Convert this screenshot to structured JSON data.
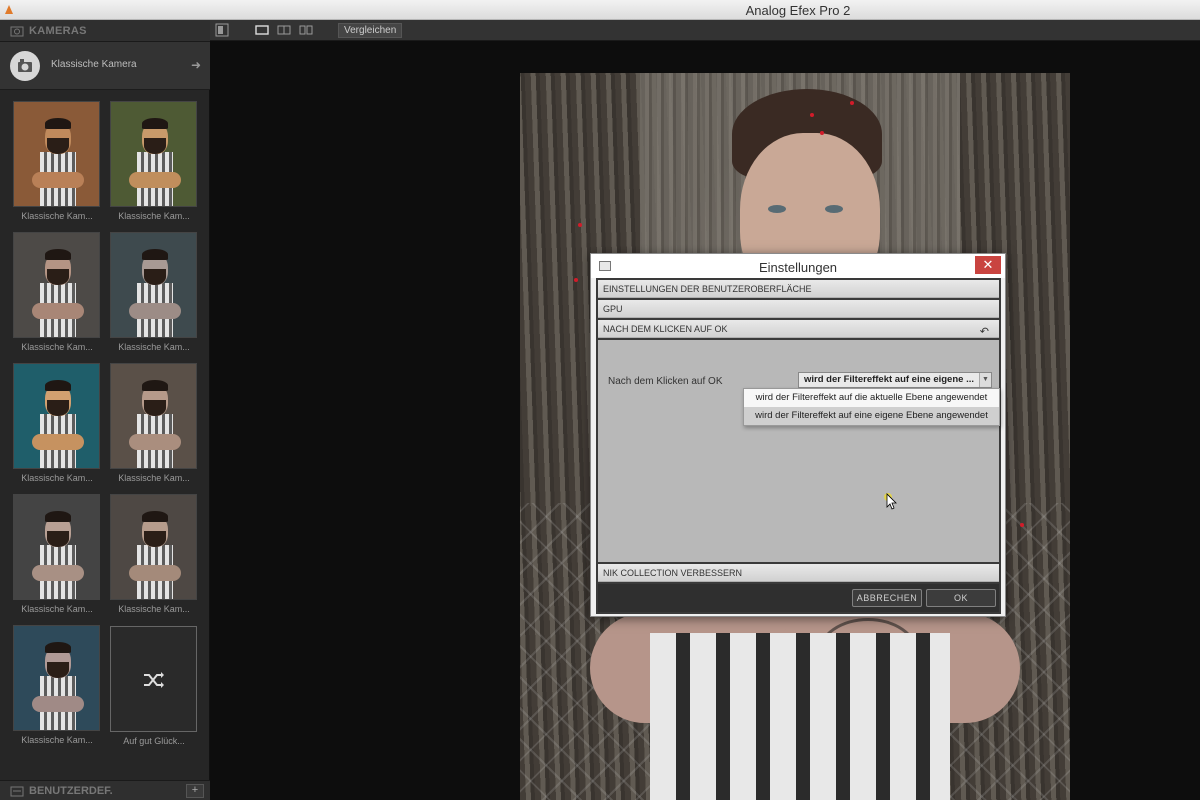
{
  "window": {
    "title": "Analog Efex Pro 2"
  },
  "toolbar": {
    "compare_label": "Vergleichen"
  },
  "left_panel": {
    "section_title": "KAMERAS",
    "camera_type": "Klassische Kamera",
    "presets": [
      {
        "label": "Klassische Kam...",
        "skin": "#c08a5c",
        "bg": "#8a5a38",
        "arms": "#b98057"
      },
      {
        "label": "Klassische Kam...",
        "skin": "#c89a6a",
        "bg": "#4e5a34",
        "arms": "#c08e5c"
      },
      {
        "label": "Klassische Kam...",
        "skin": "#b49484",
        "bg": "#4d4a47",
        "arms": "#a88676"
      },
      {
        "label": "Klassische Kam...",
        "skin": "#a89a94",
        "bg": "#3e4a4e",
        "arms": "#9c8c86"
      },
      {
        "label": "Klassische Kam...",
        "skin": "#d2a070",
        "bg": "#1f5e6a",
        "arms": "#c69260"
      },
      {
        "label": "Klassische Kam...",
        "skin": "#b69a8a",
        "bg": "#5a5048",
        "arms": "#aa8e7e"
      },
      {
        "label": "Klassische Kam...",
        "skin": "#b8a094",
        "bg": "#444",
        "arms": "#a89084"
      },
      {
        "label": "Klassische Kam...",
        "skin": "#b69c8c",
        "bg": "#4e4844",
        "arms": "#a48a7a"
      },
      {
        "label": "Klassische Kam...",
        "skin": "#b09a96",
        "bg": "#2e4a5a",
        "arms": "#a08a86"
      }
    ],
    "random_label": "Auf gut Glück...",
    "footer_label": "BENUTZERDEF."
  },
  "dialog": {
    "title": "Einstellungen",
    "close_label": "✕",
    "sections": {
      "ui": "EINSTELLUNGEN DER BENUTZEROBERFLÄCHE",
      "gpu": "GPU",
      "after_ok": "NACH DEM KLICKEN AUF OK",
      "improve": "NIK COLLECTION VERBESSERN"
    },
    "after_ok_label": "Nach dem Klicken auf OK",
    "select_value": "wird der Filtereffekt auf eine eigene ...",
    "options": [
      "wird der Filtereffekt auf die aktuelle Ebene angewendet",
      "wird der Filtereffekt auf eine eigene Ebene angewendet"
    ],
    "selected_option_index": 1,
    "cancel_label": "ABBRECHEN",
    "ok_label": "OK"
  },
  "colors": {
    "panel": "#262626",
    "accent_close": "#c94440",
    "highlight_dots": "#d21c2a"
  }
}
